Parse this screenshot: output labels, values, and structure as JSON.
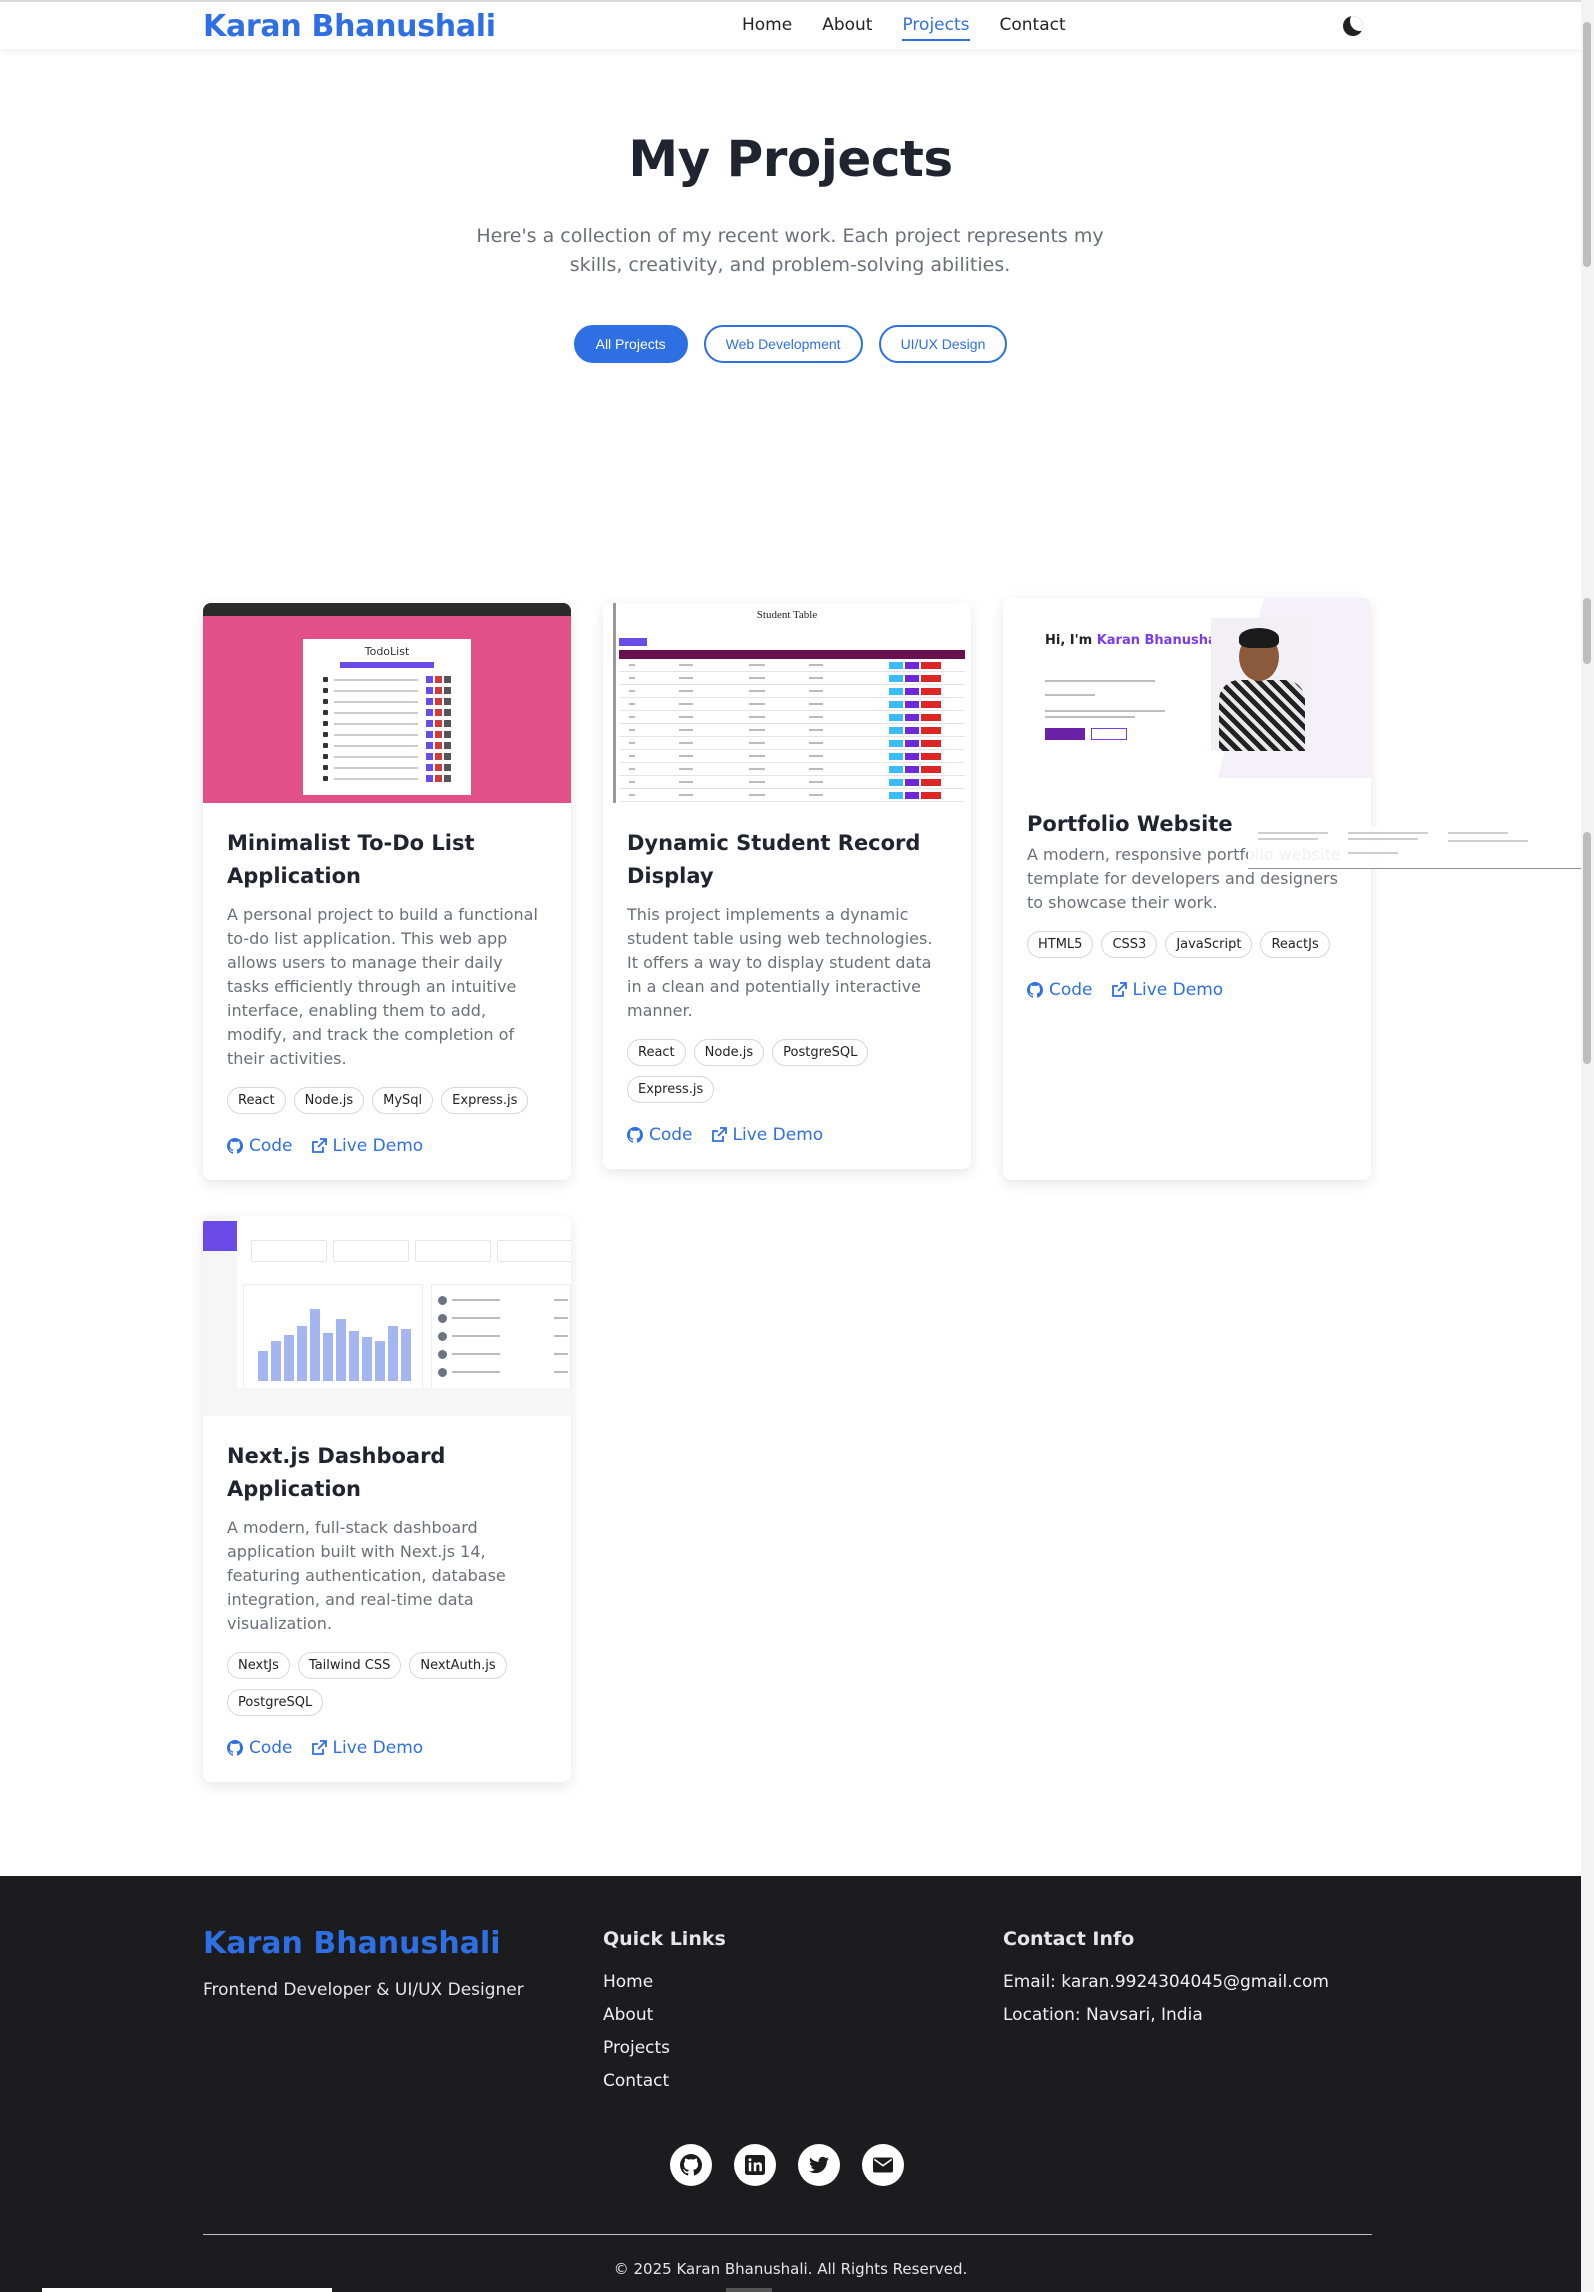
{
  "nav": {
    "brand": "Karan Bhanushali",
    "links": [
      "Home",
      "About",
      "Projects",
      "Contact"
    ],
    "active": "Projects"
  },
  "hero": {
    "title": "My Projects",
    "subtitle": "Here's a collection of my recent work. Each project represents my skills, creativity, and problem-solving abilities."
  },
  "filters": [
    "All Projects",
    "Web Development",
    "UI/UX Design"
  ],
  "colors": {
    "accent": "#2f6fe4",
    "footer_bg": "#1c1c1e",
    "todo_bg": "#e2508a"
  },
  "projects": [
    {
      "title": "Minimalist To-Do List Application",
      "description": "A personal project to build a functional to-do list application. This web app allows users to manage their daily tasks efficiently through an intuitive interface, enabling them to add, modify, and track the completion of their activities.",
      "tags": [
        "React",
        "Node.js",
        "MySql",
        "Express.js"
      ],
      "code_label": "Code",
      "demo_label": "Live Demo",
      "thumb_text": "TodoList"
    },
    {
      "title": "Dynamic Student Record Display",
      "description": "This project implements a dynamic student table using web technologies. It offers a way to display student data in a clean and potentially interactive manner.",
      "tags": [
        "React",
        "Node.js",
        "PostgreSQL",
        "Express.js"
      ],
      "code_label": "Code",
      "demo_label": "Live Demo",
      "thumb_text": "Student Table"
    },
    {
      "title": "Portfolio Website",
      "description": "A modern, responsive portfolio website template for developers and designers to showcase their work.",
      "tags": [
        "HTML5",
        "CSS3",
        "JavaScript",
        "ReactJs"
      ],
      "code_label": "Code",
      "demo_label": "Live Demo",
      "thumb_hi": "Hi, I'm ",
      "thumb_name": "Karan Bhanushali"
    },
    {
      "title": "Next.js Dashboard Application",
      "description": "A modern, full-stack dashboard application built with Next.js 14, featuring authentication, database integration, and real-time data visualization.",
      "tags": [
        "NextJs",
        "Tailwind CSS",
        "NextAuth.js",
        "PostgreSQL"
      ],
      "code_label": "Code",
      "demo_label": "Live Demo"
    }
  ],
  "footer": {
    "brand": "Karan Bhanushali",
    "tagline": "Frontend Developer & UI/UX Designer",
    "quick_links_title": "Quick Links",
    "quick_links": [
      "Home",
      "About",
      "Projects",
      "Contact"
    ],
    "contact_title": "Contact Info",
    "email": "Email: karan.9924304045@gmail.com",
    "location": "Location: Navsari, India",
    "social_icons": [
      "github-icon",
      "linkedin-icon",
      "twitter-icon",
      "envelope-icon"
    ],
    "copyright": "© 2025 Karan Bhanushali. All Rights Reserved."
  }
}
